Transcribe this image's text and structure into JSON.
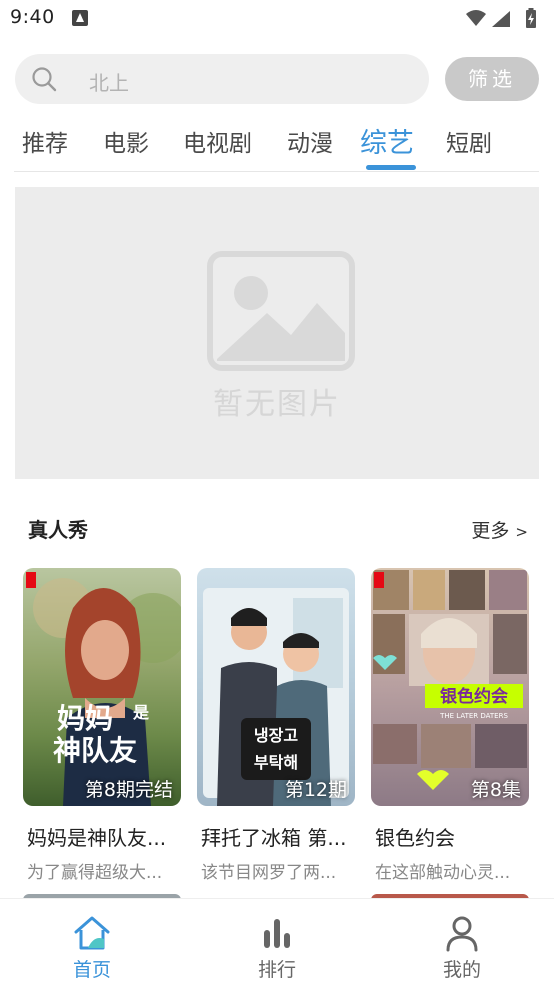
{
  "status_bar": {
    "time": "9:40"
  },
  "search": {
    "placeholder_text": "北上",
    "filter_label": "筛选"
  },
  "tabs": [
    {
      "label": "推荐"
    },
    {
      "label": "电影"
    },
    {
      "label": "电视剧"
    },
    {
      "label": "动漫"
    },
    {
      "label": "综艺",
      "active": true
    },
    {
      "label": "短剧"
    }
  ],
  "banner": {
    "placeholder_text": "暂无图片"
  },
  "section": {
    "title": "真人秀",
    "more_label": "更多",
    "more_chevron": ">"
  },
  "cards": [
    {
      "title": "妈妈是神队友...",
      "description": "为了赢得超级大...",
      "badge": "第8期完结",
      "poster_text": [
        "妈妈",
        "是",
        "神队友"
      ]
    },
    {
      "title": "拜托了冰箱 第...",
      "description": "该节目网罗了两...",
      "badge": "第12期",
      "poster_text": [
        "냉장고",
        "부탁해"
      ]
    },
    {
      "title": "银色约会",
      "description": "在这部触动心灵...",
      "badge": "第8集",
      "poster_text": [
        "银色约会",
        "THE LATER DATERS"
      ]
    }
  ],
  "bottom_nav": [
    {
      "label": "首页",
      "icon": "home-icon",
      "active": true
    },
    {
      "label": "排行",
      "icon": "bar-chart-icon"
    },
    {
      "label": "我的",
      "icon": "person-icon"
    }
  ],
  "colors": {
    "accent": "#3b93d9",
    "filter_button_bg": "#c9c9c9",
    "search_bg": "#efefef"
  }
}
